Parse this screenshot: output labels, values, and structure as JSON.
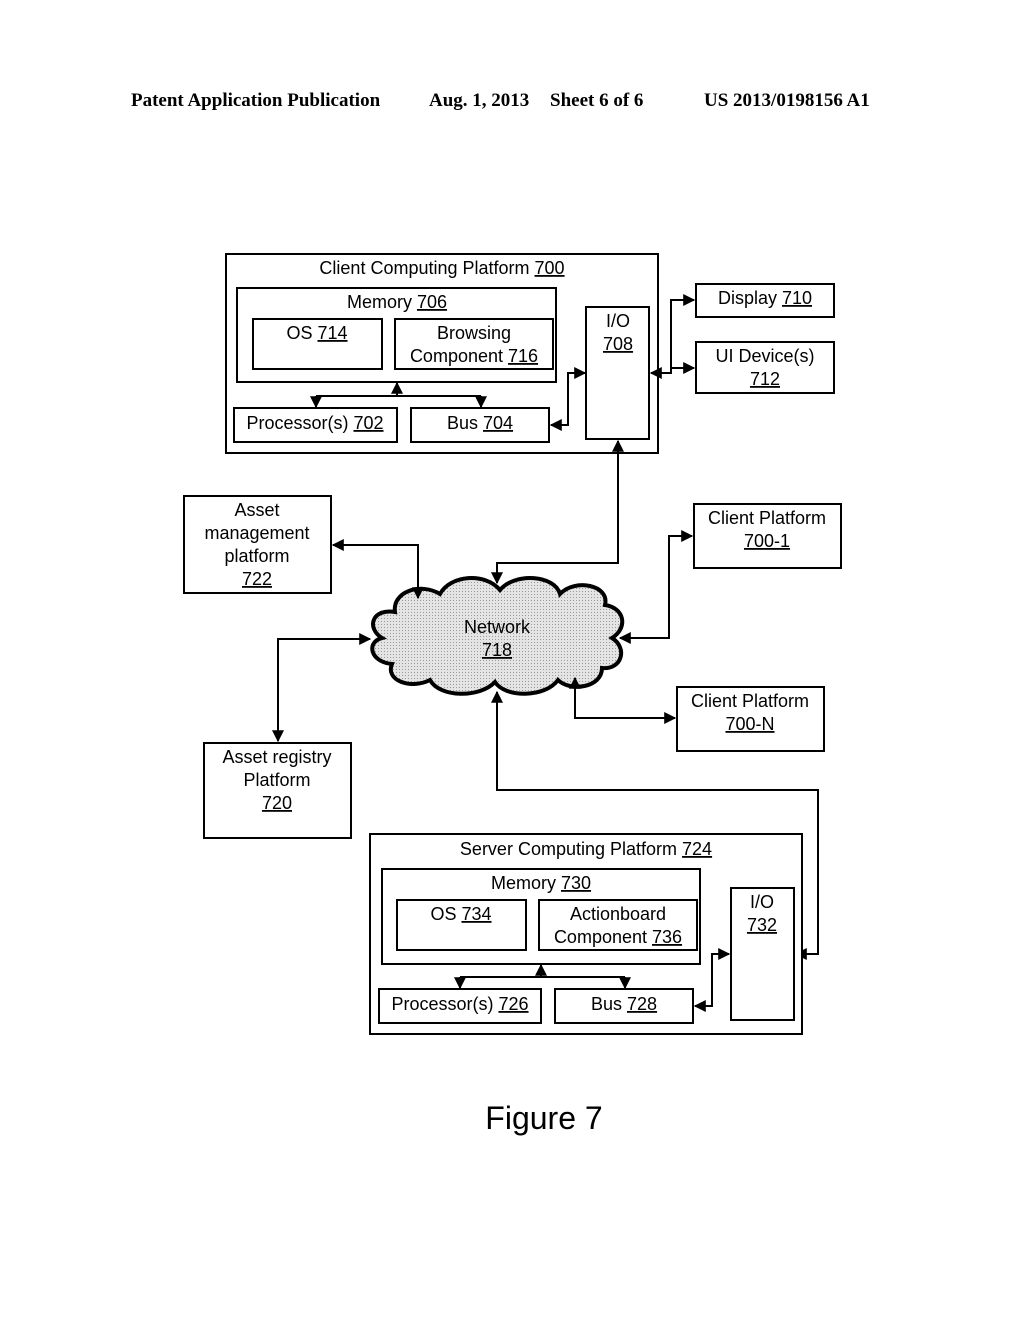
{
  "header": {
    "publication": "Patent Application Publication",
    "date": "Aug. 1, 2013",
    "sheet": "Sheet 6 of 6",
    "number": "US 2013/0198156 A1"
  },
  "diagram": {
    "client_platform": {
      "label": "Client Computing Platform",
      "ref": "700"
    },
    "client_memory": {
      "label": "Memory",
      "ref": "706"
    },
    "client_os": {
      "label": "OS",
      "ref": "714"
    },
    "browsing": {
      "line1": "Browsing",
      "label": "Component",
      "ref": "716"
    },
    "client_processor": {
      "label": "Processor(s)",
      "ref": "702"
    },
    "client_bus": {
      "label": "Bus",
      "ref": "704"
    },
    "client_io": {
      "label": "I/O",
      "ref": "708"
    },
    "display": {
      "label": "Display",
      "ref": "710"
    },
    "ui_device": {
      "label": "UI Device(s)",
      "ref": "712"
    },
    "asset_mgmt": {
      "line1": "Asset",
      "line2": "management",
      "line3": "platform",
      "ref": "722"
    },
    "network": {
      "label": "Network",
      "ref": "718"
    },
    "client_700_1": {
      "label": "Client Platform",
      "ref": "700-1"
    },
    "client_700_n": {
      "label": "Client Platform",
      "ref": "700-N"
    },
    "asset_registry": {
      "line1": "Asset registry",
      "line2": "Platform",
      "ref": "720"
    },
    "server_platform": {
      "label": "Server Computing Platform",
      "ref": "724"
    },
    "server_memory": {
      "label": "Memory",
      "ref": "730"
    },
    "server_os": {
      "label": "OS",
      "ref": "734"
    },
    "actionboard": {
      "line1": "Actionboard",
      "label": "Component",
      "ref": "736"
    },
    "server_processor": {
      "label": "Processor(s)",
      "ref": "726"
    },
    "server_bus": {
      "label": "Bus",
      "ref": "728"
    },
    "server_io": {
      "label": "I/O",
      "ref": "732"
    }
  },
  "caption": "Figure 7"
}
